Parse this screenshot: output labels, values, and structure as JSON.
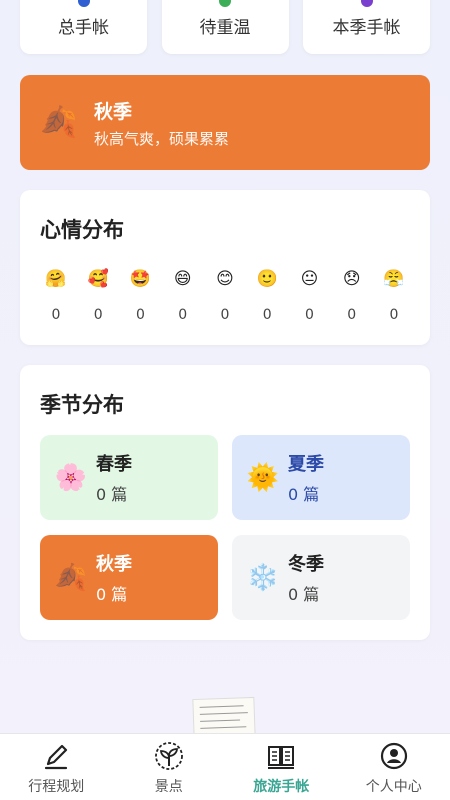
{
  "stats": {
    "items": [
      {
        "label": "总手帐",
        "dot_color": "#2f5fd0"
      },
      {
        "label": "待重温",
        "dot_color": "#3cae58"
      },
      {
        "label": "本季手帐",
        "dot_color": "#7b3fd0"
      }
    ]
  },
  "banner": {
    "icon": "🍂",
    "icon_name": "fallen-leaf-icon",
    "title": "秋季",
    "subtitle": "秋高气爽，硕果累累",
    "color": "#ec7b35"
  },
  "mood": {
    "title": "心情分布",
    "items": [
      {
        "emoji": "🤗",
        "count": "0"
      },
      {
        "emoji": "🥰",
        "count": "0"
      },
      {
        "emoji": "🤩",
        "count": "0"
      },
      {
        "emoji": "😄",
        "count": "0"
      },
      {
        "emoji": "😊",
        "count": "0"
      },
      {
        "emoji": "🙂",
        "count": "0"
      },
      {
        "emoji": "😐",
        "count": "0"
      },
      {
        "emoji": "😞",
        "count": "0"
      },
      {
        "emoji": "😤",
        "count": "0"
      }
    ]
  },
  "seasons": {
    "title": "季节分布",
    "spring": {
      "icon": "🌸",
      "name": "春季",
      "count": "0 篇"
    },
    "summer": {
      "icon": "🌞",
      "name": "夏季",
      "count": "0 篇"
    },
    "autumn": {
      "icon": "🍂",
      "name": "秋季",
      "count": "0 篇"
    },
    "winter": {
      "icon": "❄️",
      "name": "冬季",
      "count": "0 篇"
    }
  },
  "nav": {
    "active_color": "#3aa593",
    "items": [
      {
        "label": "行程规划",
        "icon": "pencil-icon"
      },
      {
        "label": "景点",
        "icon": "plant-icon"
      },
      {
        "label": "旅游手帐",
        "icon": "book-icon"
      },
      {
        "label": "个人中心",
        "icon": "user-icon"
      }
    ]
  }
}
